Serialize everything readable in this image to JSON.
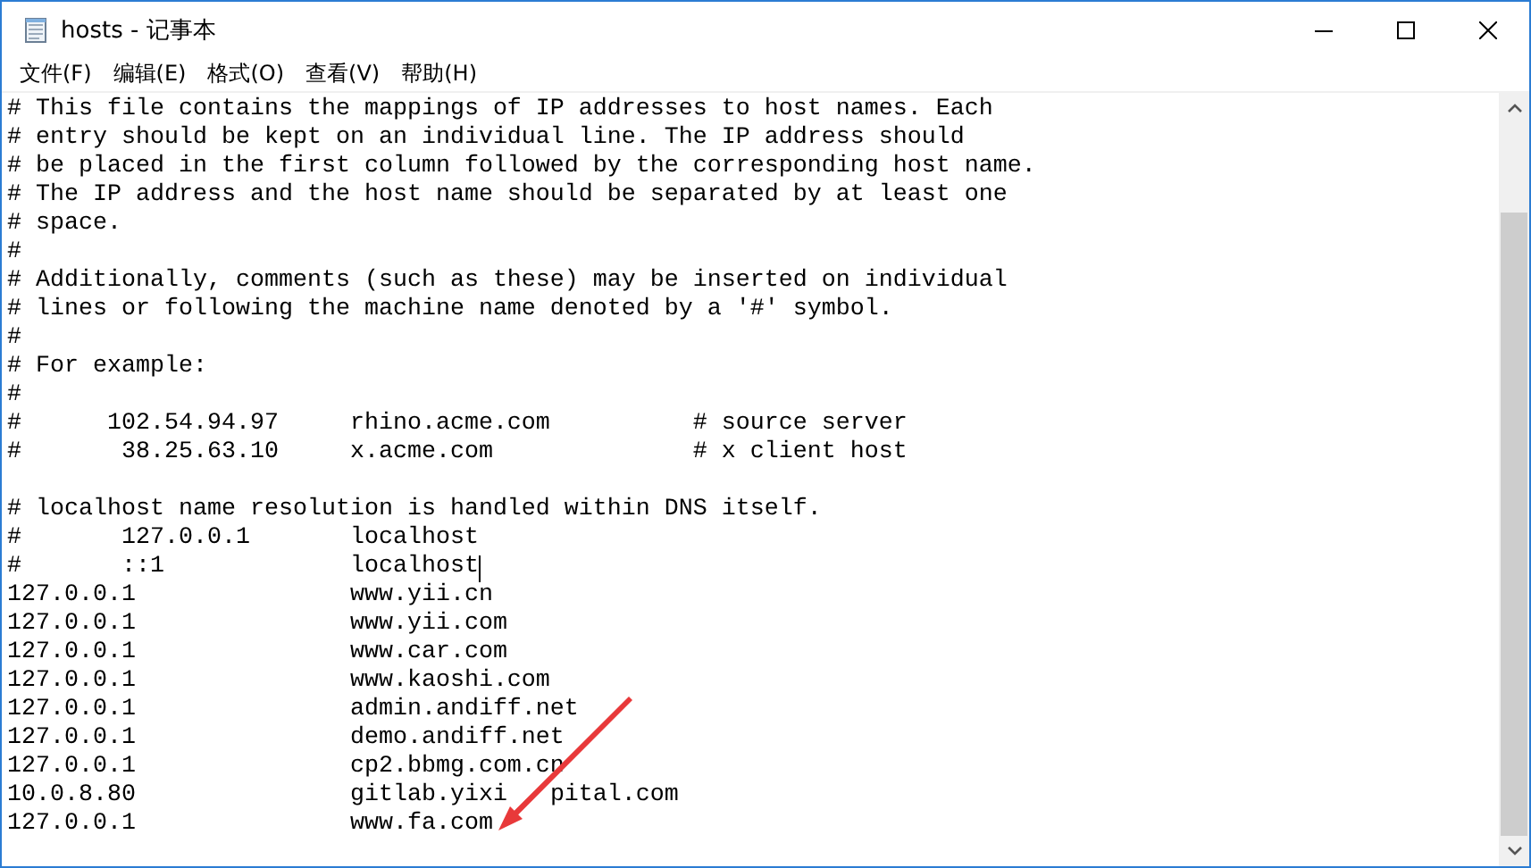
{
  "window": {
    "title": "hosts - 记事本"
  },
  "menu": [
    {
      "label": "文件(F)"
    },
    {
      "label": "编辑(E)"
    },
    {
      "label": "格式(O)"
    },
    {
      "label": "查看(V)"
    },
    {
      "label": "帮助(H)"
    }
  ],
  "lines": [
    {
      "kind": "text",
      "text": "# This file contains the mappings of IP addresses to host names. Each",
      "caret": false
    },
    {
      "kind": "text",
      "text": "# entry should be kept on an individual line. The IP address should",
      "caret": false
    },
    {
      "kind": "text",
      "text": "# be placed in the first column followed by the corresponding host name.",
      "caret": false
    },
    {
      "kind": "text",
      "text": "# The IP address and the host name should be separated by at least one",
      "caret": false
    },
    {
      "kind": "text",
      "text": "# space.",
      "caret": false
    },
    {
      "kind": "text",
      "text": "#",
      "caret": false
    },
    {
      "kind": "text",
      "text": "# Additionally, comments (such as these) may be inserted on individual",
      "caret": false
    },
    {
      "kind": "text",
      "text": "# lines or following the machine name denoted by a '#' symbol.",
      "caret": false
    },
    {
      "kind": "text",
      "text": "#",
      "caret": false
    },
    {
      "kind": "text",
      "text": "# For example:",
      "caret": false
    },
    {
      "kind": "text",
      "text": "#",
      "caret": false
    },
    {
      "kind": "text",
      "text": "#      102.54.94.97     rhino.acme.com          # source server",
      "caret": false
    },
    {
      "kind": "text",
      "text": "#       38.25.63.10     x.acme.com              # x client host",
      "caret": false
    },
    {
      "kind": "blank"
    },
    {
      "kind": "text",
      "text": "# localhost name resolution is handled within DNS itself.",
      "caret": false
    },
    {
      "kind": "text",
      "text": "#       127.0.0.1       localhost",
      "caret": false
    },
    {
      "kind": "text",
      "text": "#       ::1             localhost",
      "caret": true
    },
    {
      "kind": "text",
      "text": "127.0.0.1               www.yii.cn",
      "caret": false
    },
    {
      "kind": "text",
      "text": "127.0.0.1               www.yii.com",
      "caret": false
    },
    {
      "kind": "text",
      "text": "127.0.0.1               www.car.com",
      "caret": false
    },
    {
      "kind": "text",
      "text": "127.0.0.1               www.kaoshi.com",
      "caret": false
    },
    {
      "kind": "text",
      "text": "127.0.0.1               admin.andiff.net",
      "caret": false
    },
    {
      "kind": "text",
      "text": "127.0.0.1               demo.andiff.net",
      "caret": false
    },
    {
      "kind": "text",
      "text": "127.0.0.1               cp2.bbmg.com.cn",
      "caret": false
    },
    {
      "kind": "covered",
      "text": "10.0.8.80               gitlab.yixi",
      "rest": "pital.com"
    },
    {
      "kind": "text",
      "text": "127.0.0.1               www.fa.com",
      "caret": false
    }
  ]
}
